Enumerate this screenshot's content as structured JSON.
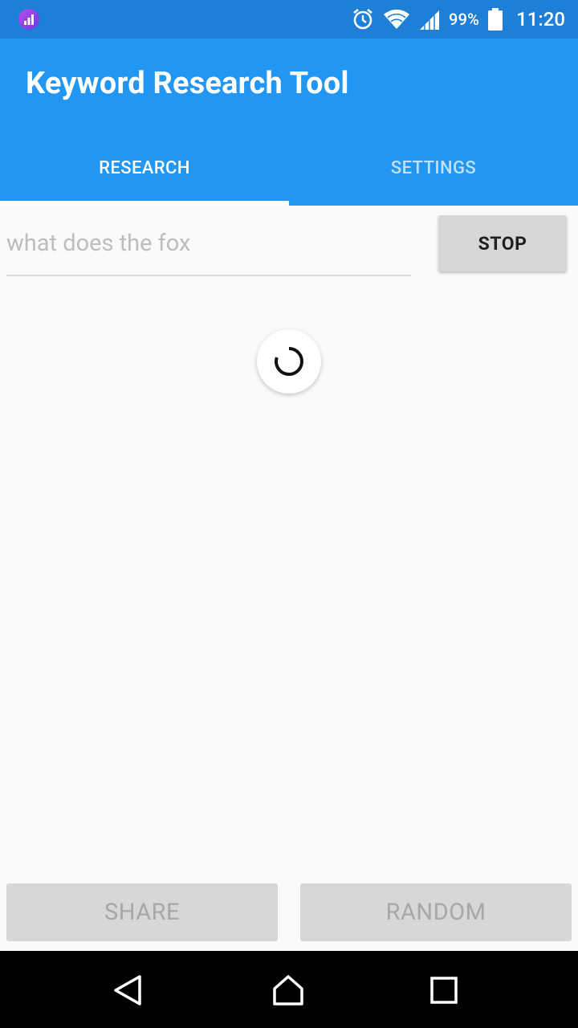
{
  "status_bar": {
    "battery_percent": "99%",
    "time": "11:20",
    "icons": [
      "app-notification-icon",
      "alarm-icon",
      "wifi-icon",
      "cell-signal-icon",
      "battery-icon"
    ]
  },
  "app_bar": {
    "title": "Keyword Research Tool",
    "tabs": [
      {
        "label": "RESEARCH",
        "active": true
      },
      {
        "label": "SETTINGS",
        "active": false
      }
    ]
  },
  "search": {
    "placeholder": "what does the fox",
    "value": ""
  },
  "actions": {
    "stop_label": "STOP",
    "share_label": "SHARE",
    "random_label": "RANDOM"
  },
  "navigation": {
    "icons": [
      "back-icon",
      "home-icon",
      "recents-icon"
    ]
  },
  "colors": {
    "status_bar": "#1e7fd6",
    "primary": "#2196f3",
    "tab_inactive": "#bfe1fb",
    "background": "#fafafa",
    "button_gray": "#d6d7d7"
  }
}
